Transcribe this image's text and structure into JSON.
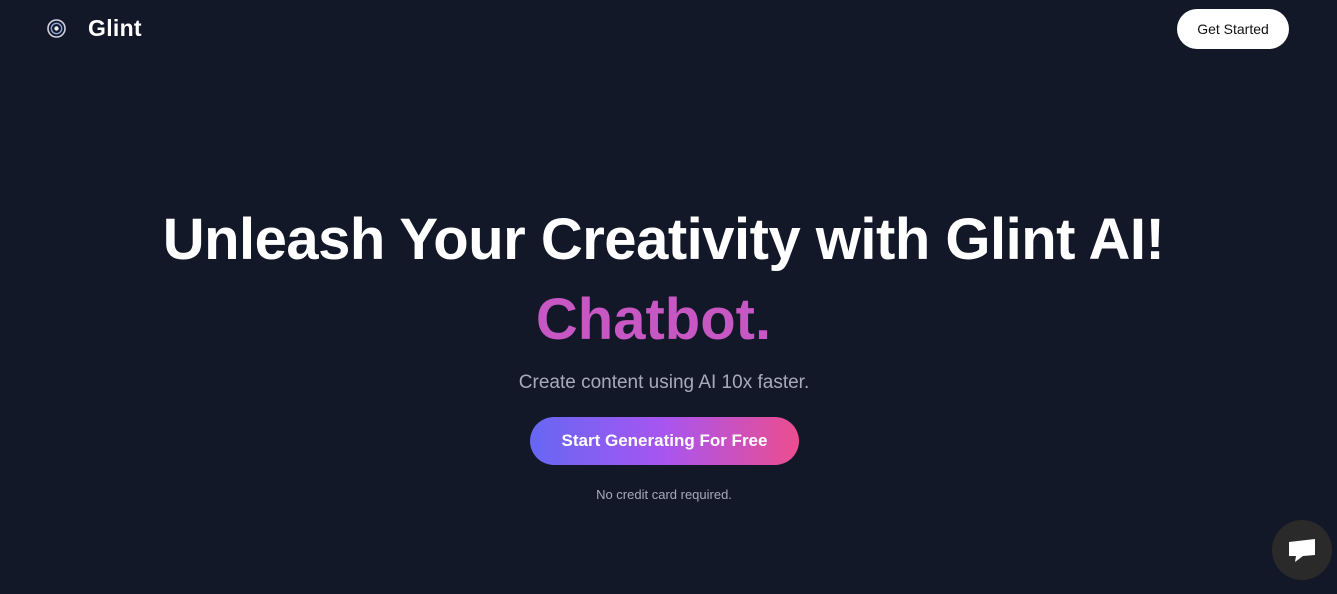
{
  "brand": {
    "name": "Glint",
    "logo_icon": "glint-logo-icon"
  },
  "header": {
    "cta_label": "Get Started"
  },
  "hero": {
    "headline": "Unleash Your Creativity with Glint AI!",
    "rotating_word": "Chatbot.",
    "subtitle": "Create content using AI 10x faster.",
    "cta_label": "Start Generating For Free",
    "note": "No credit card required."
  },
  "chat_widget": {
    "icon": "chat-bubble-icon"
  },
  "colors": {
    "background": "#131829",
    "accent_word": "#c757c3",
    "cta_gradient_start": "#6667f4",
    "cta_gradient_mid": "#a855f0",
    "cta_gradient_end": "#ec4d8f",
    "muted_text": "#a7abb8"
  }
}
